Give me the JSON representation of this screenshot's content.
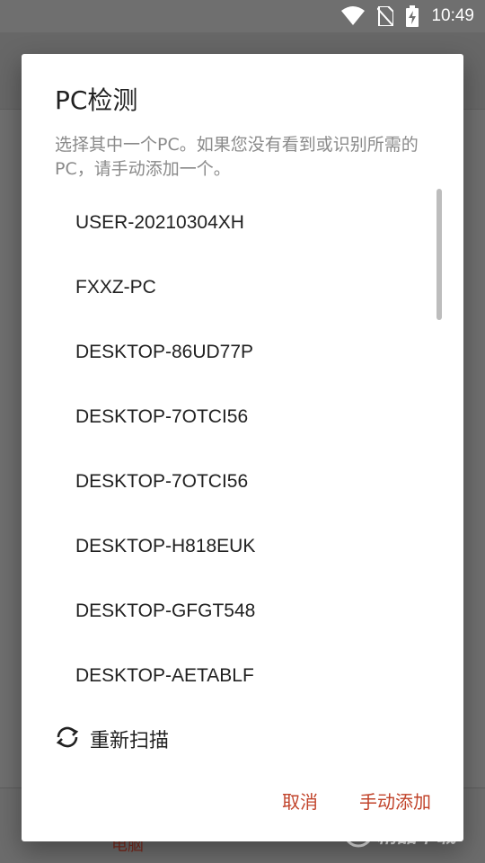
{
  "status_bar": {
    "time": "10:49",
    "icons": [
      "wifi-icon",
      "no-sim-icon",
      "battery-charging-icon"
    ]
  },
  "background": {
    "bottom_tab_label": "电脑"
  },
  "dialog": {
    "title": "PC检测",
    "description": "选择其中一个PC。如果您没有看到或识别所需的PC，请手动添加一个。",
    "pc_list": [
      "USER-20210304XH",
      "FXXZ-PC",
      "DESKTOP-86UD77P",
      "DESKTOP-7OTCI56",
      "DESKTOP-7OTCI56",
      "DESKTOP-H818EUK",
      "DESKTOP-GFGT548",
      "DESKTOP-AETABLF"
    ],
    "rescan_label": "重新扫描",
    "rescan_icon": "refresh-icon",
    "cancel_label": "取消",
    "manual_add_label": "手动添加"
  },
  "watermark": {
    "text": "精品下载"
  },
  "colors": {
    "accent": "#c1432a",
    "dialog_bg": "#ffffff",
    "scrim": "#6f6f6f"
  }
}
